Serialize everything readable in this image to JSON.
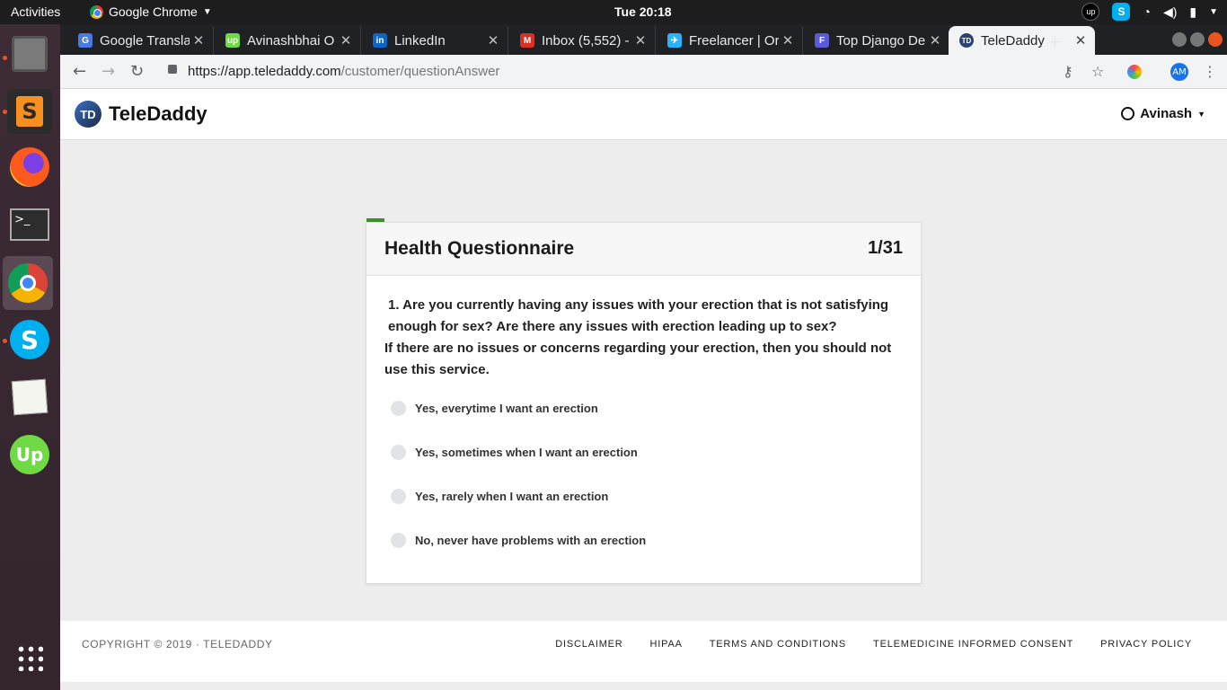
{
  "system": {
    "activities": "Activities",
    "app_name": "Google Chrome",
    "clock": "Tue 20:18"
  },
  "browser": {
    "tabs": [
      {
        "label": "Google Transla",
        "icon": "google-translate-icon",
        "color": "#4a7ae0"
      },
      {
        "label": "Avinashbhai O",
        "icon": "upwork-icon",
        "color": "#6fda44"
      },
      {
        "label": "LinkedIn",
        "icon": "linkedin-icon",
        "color": "#0a66c2"
      },
      {
        "label": "Inbox (5,552) -",
        "icon": "gmail-icon",
        "color": "#d93025"
      },
      {
        "label": "Freelancer | Or",
        "icon": "freelancer-icon",
        "color": "#29b2fe"
      },
      {
        "label": "Top Django De",
        "icon": "django-icon",
        "color": "#5b5bd6"
      },
      {
        "label": "TeleDaddy",
        "icon": "teledaddy-icon",
        "color": "#2a4370"
      }
    ],
    "url_host": "https://app.teledaddy.com",
    "url_path": "/customer/questionAnswer",
    "profile_initials": "AM"
  },
  "site": {
    "brand": "TeleDaddy",
    "logo_initials": "TD",
    "user_name": "Avinash"
  },
  "questionnaire": {
    "title": "Health Questionnaire",
    "counter": "1/31",
    "progress_fraction": 0.032,
    "question_line1": "1. Are you currently having any issues with your erection that is not satisfying enough for sex?  Are there any issues with erection leading up to sex?",
    "question_line2": "If there are no issues or concerns regarding your erection, then you should not use this service.",
    "options": [
      "Yes, everytime I want an erection",
      "Yes, sometimes when I want an erection",
      "Yes, rarely when I want an erection",
      "No, never have problems with an erection"
    ]
  },
  "footer": {
    "copyright": "COPYRIGHT © 2019 · TELEDADDY",
    "links": [
      "DISCLAIMER",
      "HIPAA",
      "TERMS AND CONDITIONS",
      "TELEMEDICINE INFORMED CONSENT",
      "PRIVACY POLICY"
    ]
  }
}
